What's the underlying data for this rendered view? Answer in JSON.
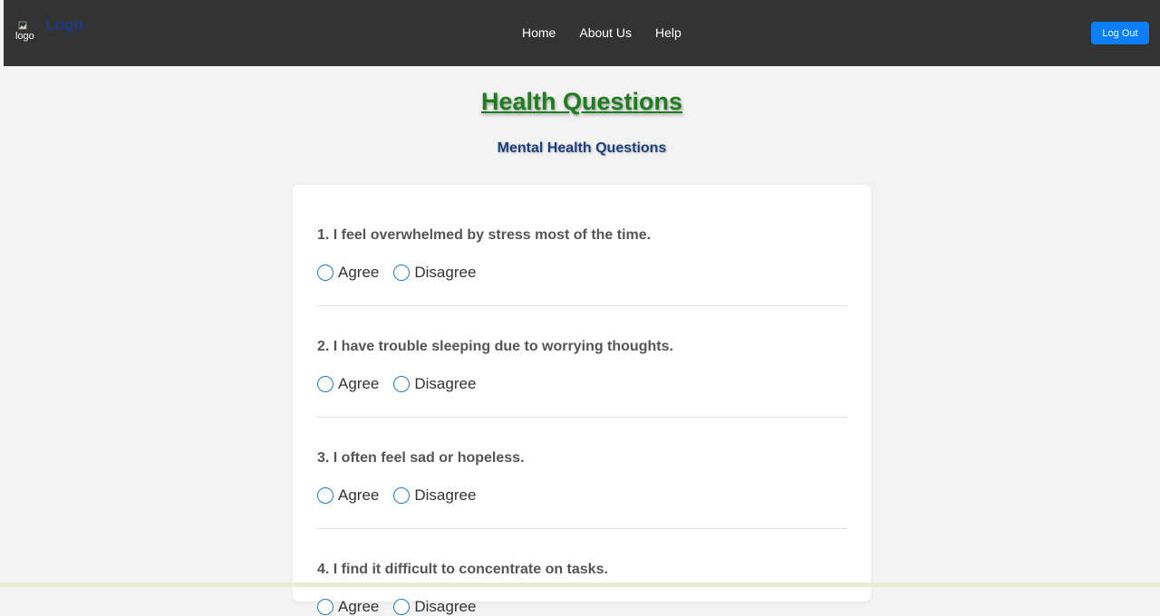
{
  "header": {
    "logo_alt": "logo",
    "logo_text": "Logo",
    "nav": [
      {
        "label": "Home"
      },
      {
        "label": "About Us"
      },
      {
        "label": "Help"
      }
    ],
    "logout_label": "Log Out"
  },
  "main": {
    "title": "Health Questions",
    "subtitle": "Mental Health Questions",
    "questions": [
      {
        "text": "1. I feel overwhelmed by stress most of the time.",
        "options": [
          "Agree",
          "Disagree"
        ]
      },
      {
        "text": "2. I have trouble sleeping due to worrying thoughts.",
        "options": [
          "Agree",
          "Disagree"
        ]
      },
      {
        "text": "3. I often feel sad or hopeless.",
        "options": [
          "Agree",
          "Disagree"
        ]
      },
      {
        "text": "4. I find it difficult to concentrate on tasks.",
        "options": [
          "Agree",
          "Disagree"
        ]
      }
    ]
  },
  "colors": {
    "navbar": "#333333",
    "title": "#1f7d1f",
    "subtitle": "#1e3f7a",
    "button": "#0d7ef5",
    "radio_border": "#1f7bc7"
  }
}
